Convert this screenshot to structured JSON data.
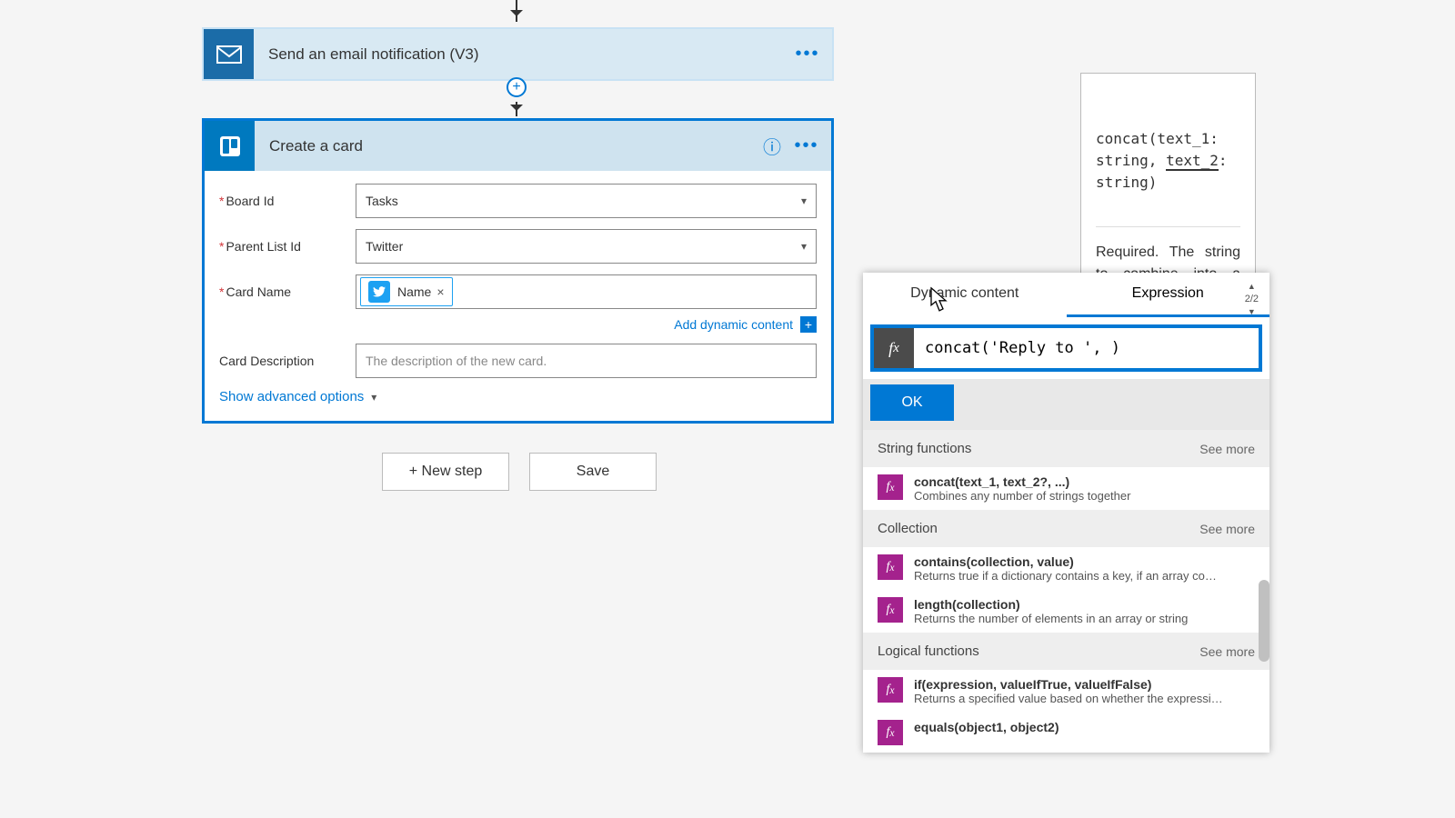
{
  "flow": {
    "step1": {
      "title": "Send an email notification (V3)"
    },
    "step2": {
      "title": "Create a card",
      "fields": {
        "boardId": {
          "label": "Board Id",
          "required": true,
          "value": "Tasks"
        },
        "parentList": {
          "label": "Parent List Id",
          "required": true,
          "value": "Twitter"
        },
        "cardName": {
          "label": "Card Name",
          "required": true,
          "token": "Name"
        },
        "cardDesc": {
          "label": "Card Description",
          "required": false,
          "placeholder": "The description of the new card."
        }
      },
      "addDynamic": "Add dynamic content",
      "showAdvanced": "Show advanced options"
    },
    "buttons": {
      "newStep": "+ New step",
      "save": "Save"
    }
  },
  "picker": {
    "tabs": {
      "dynamic": "Dynamic content",
      "expression": "Expression"
    },
    "pager": "2/2",
    "fx": "concat('Reply to ', )",
    "ok": "OK",
    "seeMore": "See more",
    "categories": [
      {
        "name": "String functions",
        "items": [
          {
            "sig": "concat(text_1, text_2?, ...)",
            "desc": "Combines any number of strings together"
          }
        ]
      },
      {
        "name": "Collection",
        "items": [
          {
            "sig": "contains(collection, value)",
            "desc": "Returns true if a dictionary contains a key, if an array cont..."
          },
          {
            "sig": "length(collection)",
            "desc": "Returns the number of elements in an array or string"
          }
        ]
      },
      {
        "name": "Logical functions",
        "items": [
          {
            "sig": "if(expression, valueIfTrue, valueIfFalse)",
            "desc": "Returns a specified value based on whether the expressio..."
          },
          {
            "sig": "equals(object1, object2)",
            "desc": ""
          }
        ]
      }
    ]
  },
  "tooltip": {
    "sig_pre": "concat(text_1: string, ",
    "sig_cur": "text_2",
    "sig_post": ": string)",
    "body": "Required. The string to combine into a single string.",
    "body2": "Combines any number of strings"
  }
}
